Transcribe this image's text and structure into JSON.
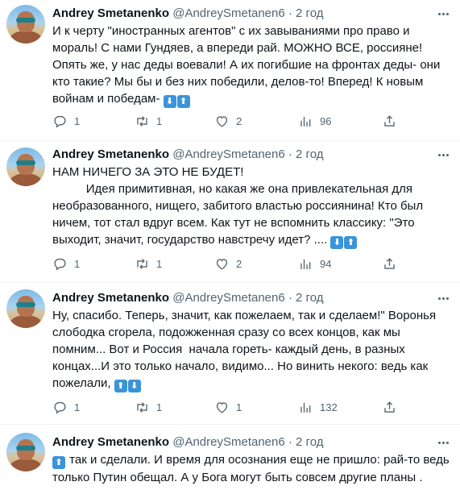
{
  "tweets": [
    {
      "author_name": "Andrey Smetanenko",
      "handle": "@AndreySmetanen6",
      "separator": "·",
      "time": "2 год",
      "text": "И к черту \"иностранных агентов\" с их завываниями про право и мораль! С нами Гундяев, а впереди рай. МОЖНО ВСЕ, россияне! Опять же, у нас деды воевали! А их погибшие на фронтах деды- они кто такие? Мы бы и без них победили, делов-то! Вперед! К новым войнам и победам- ",
      "emojis": [
        "down-arrow-emoji",
        "up-arrow-emoji"
      ],
      "replies": "1",
      "retweets": "1",
      "likes": "2",
      "views": "96"
    },
    {
      "author_name": "Andrey Smetanenko",
      "handle": "@AndreySmetanen6",
      "separator": "·",
      "time": "2 год",
      "text": "НАМ НИЧЕГО ЗА ЭТО НЕ БУДЕТ!\n          Идея примитивная, но какая же она привлекательная для необразованного, нищего, забитого властью россиянина! Кто был ничем, тот стал вдруг всем. Как тут не вспомнить классику: \"Это выходит, значит, государство навстречу идет? .... ",
      "emojis": [
        "down-arrow-emoji",
        "up-arrow-emoji"
      ],
      "replies": "1",
      "retweets": "1",
      "likes": "2",
      "views": "94"
    },
    {
      "author_name": "Andrey Smetanenko",
      "handle": "@AndreySmetanen6",
      "separator": "·",
      "time": "2 год",
      "text": "Ну, спасибо. Теперь, значит, как пожелаем, так и сделаем!\" Воронья слободка сгорела, подожженная сразу со всех концов, как мы помним... Вот и Россия  начала гореть- каждый день, в разных концах...И это только начало, видимо... Но винить некого: ведь как пожелали, ",
      "emojis": [
        "up-arrow-emoji",
        "down-arrow-emoji"
      ],
      "replies": "1",
      "retweets": "1",
      "likes": "1",
      "views": "132"
    },
    {
      "author_name": "Andrey Smetanenko",
      "handle": "@AndreySmetanen6",
      "separator": "·",
      "time": "2 год",
      "text_emoji": "up-arrow-emoji",
      "text": " так и сделали. И время для осознания еще не пришло: рай-то ведь только Путин обещал. А у Бога могут быть совсем другие планы ."
    }
  ]
}
